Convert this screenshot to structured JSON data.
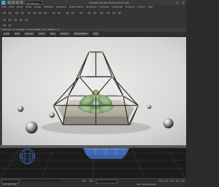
{
  "window": {
    "workspace": "Workspaces: Default",
    "title": "Autodesk 3ds Max 2016    terrarium.max",
    "controls": {
      "minimize": "–",
      "maximize": "□",
      "close": "×"
    }
  },
  "menu": [
    "Edit",
    "Tools",
    "Group",
    "Views",
    "Create",
    "Modifiers",
    "Animation",
    "Graph Editors",
    "Rendering",
    "Civil View",
    "Customize",
    "Scripting",
    "Content",
    "Help"
  ],
  "view_tab": "Camera: 1.0, Scale(s): 2 Frame Buffer (1:1), 1000px, 1:1",
  "viewport_toolbar": [
    "View",
    "Edit",
    "Refresh",
    "Save",
    "Tiles",
    "Region",
    "IMAGE PROC",
    "Edit"
  ],
  "statusbar": {
    "left": "Add Time Tag",
    "right": "Auto Key  Selected"
  },
  "colors": {
    "accent": "#3aa3c8",
    "scene_bg": "#d9d9d7",
    "lower_viewport_grid": "#4a78c8"
  }
}
